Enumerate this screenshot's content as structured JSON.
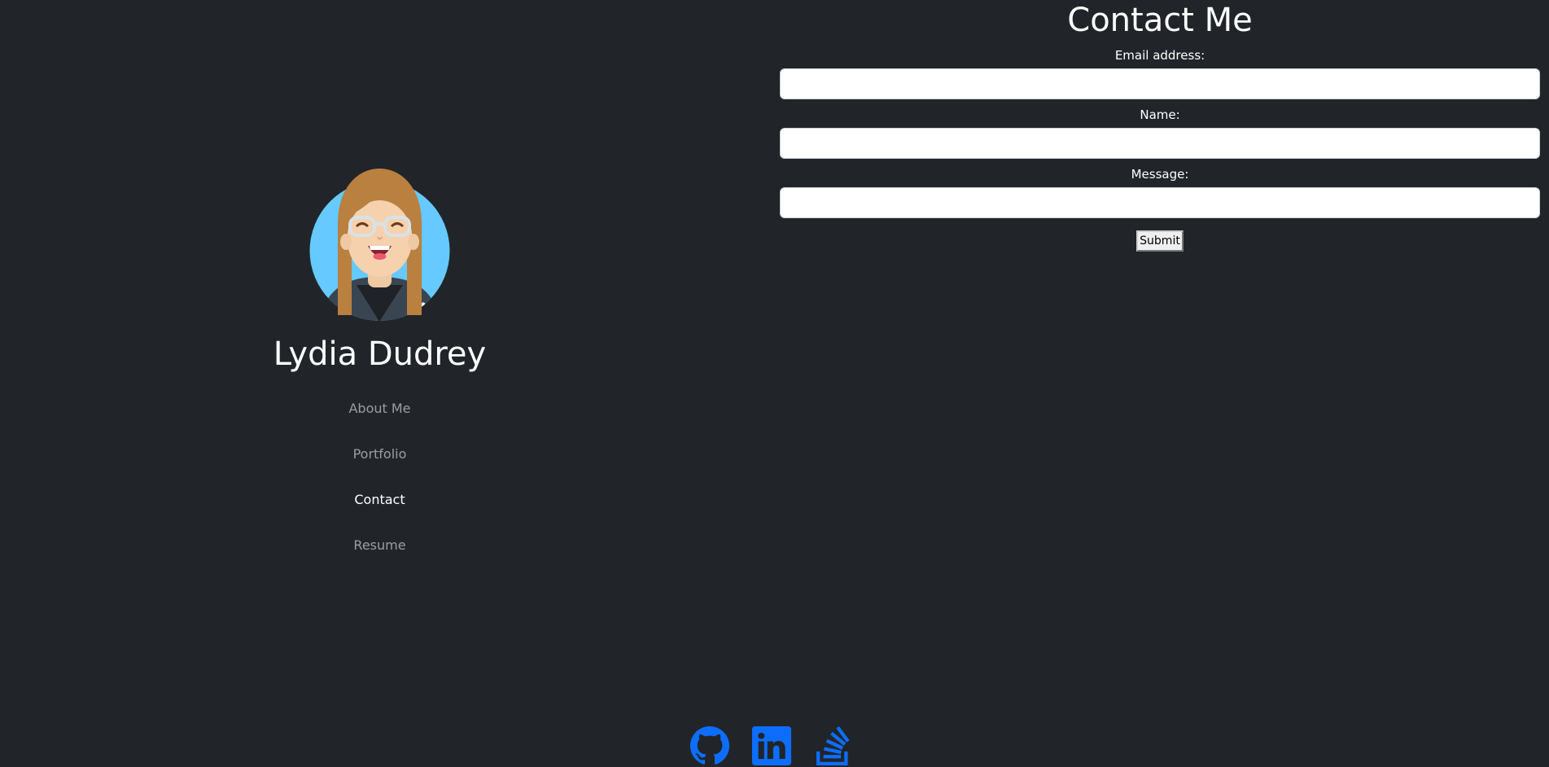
{
  "profile": {
    "name": "Lydia Dudrey"
  },
  "nav": {
    "items": [
      {
        "label": "About Me",
        "active": false
      },
      {
        "label": "Portfolio",
        "active": false
      },
      {
        "label": "Contact",
        "active": true
      },
      {
        "label": "Resume",
        "active": false
      }
    ]
  },
  "contact": {
    "title": "Contact Me",
    "email_label": "Email address:",
    "email_value": "",
    "name_label": "Name:",
    "name_value": "",
    "message_label": "Message:",
    "message_value": "",
    "submit_label": "Submit"
  },
  "social": [
    {
      "icon": "github-icon"
    },
    {
      "icon": "linkedin-icon"
    },
    {
      "icon": "stackoverflow-icon"
    }
  ],
  "colors": {
    "background": "#212529",
    "nav_inactive": "rgba(255,255,255,0.55)",
    "nav_active": "#ffffff",
    "social_icon": "#0d6efd"
  }
}
